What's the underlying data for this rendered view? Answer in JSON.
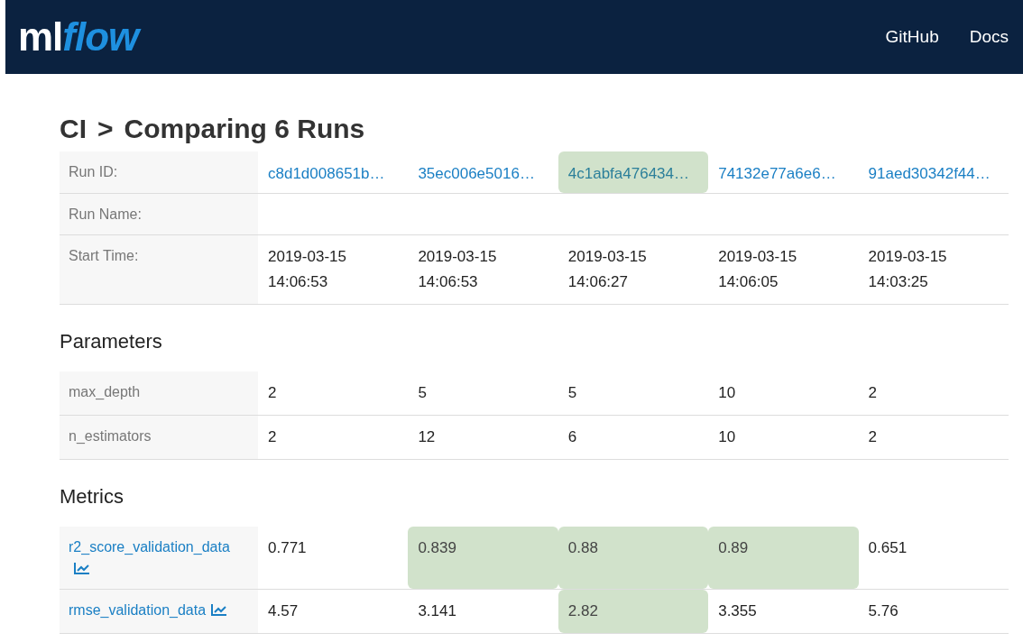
{
  "header": {
    "logo": {
      "plain": "ml",
      "accent": "flow"
    },
    "links": [
      "GitHub",
      "Docs"
    ]
  },
  "title": {
    "experiment": "CI",
    "separator": ">",
    "text": "Comparing 6 Runs"
  },
  "sections": [
    {
      "kind": "rows",
      "metric": false,
      "rows": [
        {
          "label": "Run ID:",
          "cells": [
            {
              "text": "c8d1d008651b…",
              "link": true,
              "highlighted": false
            },
            {
              "text": "35ec006e5016…",
              "link": true,
              "highlighted": false
            },
            {
              "text": "4c1abfa476434…",
              "link": true,
              "highlighted": true
            },
            {
              "text": "74132e77a6e6…",
              "link": true,
              "highlighted": false
            },
            {
              "text": "91aed30342f44…",
              "link": true,
              "highlighted": false
            }
          ]
        },
        {
          "label": "Run Name:",
          "cells": []
        },
        {
          "label": "Start Time:",
          "cells": [
            {
              "text": "2019-03-15\n14:06:53",
              "link": false,
              "highlighted": false
            },
            {
              "text": "2019-03-15\n14:06:53",
              "link": false,
              "highlighted": false
            },
            {
              "text": "2019-03-15\n14:06:27",
              "link": false,
              "highlighted": false
            },
            {
              "text": "2019-03-15\n14:06:05",
              "link": false,
              "highlighted": false
            },
            {
              "text": "2019-03-15\n14:03:25",
              "link": false,
              "highlighted": false
            }
          ]
        }
      ]
    },
    {
      "kind": "heading",
      "title": "Parameters"
    },
    {
      "kind": "rows",
      "metric": false,
      "rows": [
        {
          "label": "max_depth",
          "cells": [
            {
              "text": "2",
              "link": false,
              "highlighted": false
            },
            {
              "text": "5",
              "link": false,
              "highlighted": false
            },
            {
              "text": "5",
              "link": false,
              "highlighted": false
            },
            {
              "text": "10",
              "link": false,
              "highlighted": false
            },
            {
              "text": "2",
              "link": false,
              "highlighted": false
            }
          ]
        },
        {
          "label": "n_estimators",
          "cells": [
            {
              "text": "2",
              "link": false,
              "highlighted": false
            },
            {
              "text": "12",
              "link": false,
              "highlighted": false
            },
            {
              "text": "6",
              "link": false,
              "highlighted": false
            },
            {
              "text": "10",
              "link": false,
              "highlighted": false
            },
            {
              "text": "2",
              "link": false,
              "highlighted": false
            }
          ]
        }
      ]
    },
    {
      "kind": "heading",
      "title": "Metrics"
    },
    {
      "kind": "rows",
      "metric": true,
      "rows": [
        {
          "label": "r2_score_validation_data",
          "cells": [
            {
              "text": "0.771",
              "link": false,
              "highlighted": false
            },
            {
              "text": "0.839",
              "link": false,
              "highlighted": true
            },
            {
              "text": "0.88",
              "link": false,
              "highlighted": true
            },
            {
              "text": "0.89",
              "link": false,
              "highlighted": true
            },
            {
              "text": "0.651",
              "link": false,
              "highlighted": false
            }
          ]
        },
        {
          "label": "rmse_validation_data",
          "cells": [
            {
              "text": "4.57",
              "link": false,
              "highlighted": false
            },
            {
              "text": "3.141",
              "link": false,
              "highlighted": false
            },
            {
              "text": "2.82",
              "link": false,
              "highlighted": true
            },
            {
              "text": "3.355",
              "link": false,
              "highlighted": false
            },
            {
              "text": "5.76",
              "link": false,
              "highlighted": false
            }
          ]
        }
      ]
    }
  ]
}
